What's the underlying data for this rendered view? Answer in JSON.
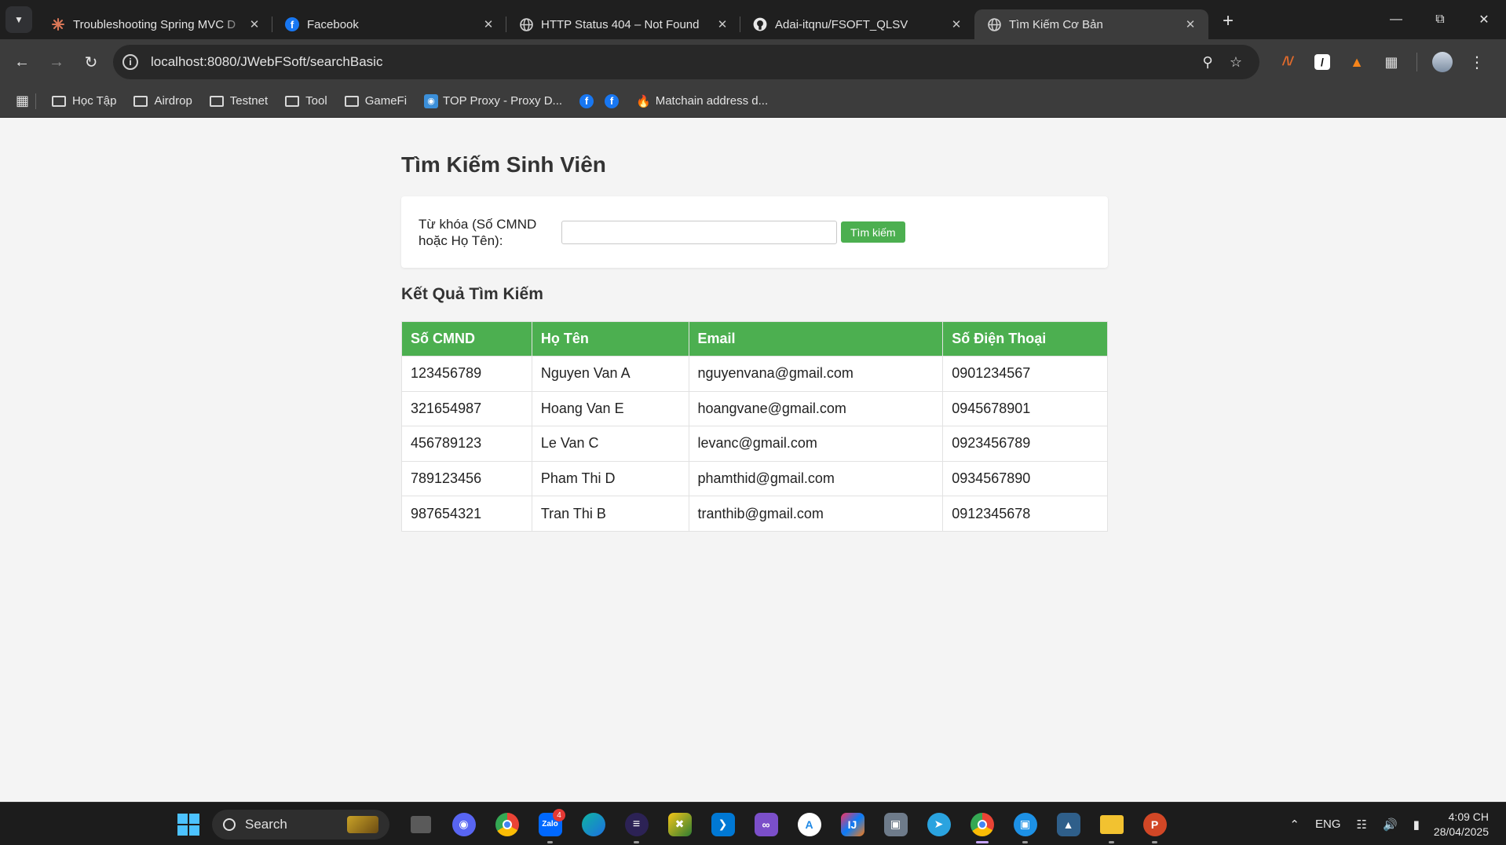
{
  "browser": {
    "tabs": [
      {
        "title": "Troubleshooting Spring MVC D",
        "icon": "claude-icon",
        "active": false
      },
      {
        "title": "Facebook",
        "icon": "facebook-icon",
        "active": false
      },
      {
        "title": "HTTP Status 404 – Not Found",
        "icon": "globe-icon",
        "active": false
      },
      {
        "title": "Adai-itqnu/FSOFT_QLSV",
        "icon": "github-icon",
        "active": false
      },
      {
        "title": "Tìm Kiếm Cơ Bản",
        "icon": "globe-icon",
        "active": true
      }
    ],
    "url": "localhost:8080/JWebFSoft/searchBasic",
    "bookmarks": [
      {
        "label": "Học Tập",
        "type": "folder"
      },
      {
        "label": "Airdrop",
        "type": "folder"
      },
      {
        "label": "Testnet",
        "type": "folder"
      },
      {
        "label": "Tool",
        "type": "folder"
      },
      {
        "label": "GameFi",
        "type": "folder"
      },
      {
        "label": "TOP Proxy - Proxy D...",
        "type": "link"
      },
      {
        "label": "",
        "type": "facebook"
      },
      {
        "label": "",
        "type": "facebook"
      },
      {
        "label": "Matchain address d...",
        "type": "link"
      }
    ]
  },
  "page": {
    "title": "Tìm Kiếm Sinh Viên",
    "search": {
      "label": "Từ khóa (Số CMND hoặc Họ Tên):",
      "value": "",
      "button": "Tìm kiếm"
    },
    "results_title": "Kết Quả Tìm Kiếm",
    "table": {
      "headers": [
        "Số CMND",
        "Họ Tên",
        "Email",
        "Số Điện Thoại"
      ],
      "rows": [
        [
          "123456789",
          "Nguyen Van A",
          "nguyenvana@gmail.com",
          "0901234567"
        ],
        [
          "321654987",
          "Hoang Van E",
          "hoangvane@gmail.com",
          "0945678901"
        ],
        [
          "456789123",
          "Le Van C",
          "levanc@gmail.com",
          "0923456789"
        ],
        [
          "789123456",
          "Pham Thi D",
          "phamthid@gmail.com",
          "0934567890"
        ],
        [
          "987654321",
          "Tran Thi B",
          "tranthib@gmail.com",
          "0912345678"
        ]
      ]
    },
    "accent_color": "#4caf50"
  },
  "taskbar": {
    "search_label": "Search",
    "zalo_badge": "4",
    "language": "ENG",
    "time": "4:09 CH",
    "date": "28/04/2025"
  }
}
